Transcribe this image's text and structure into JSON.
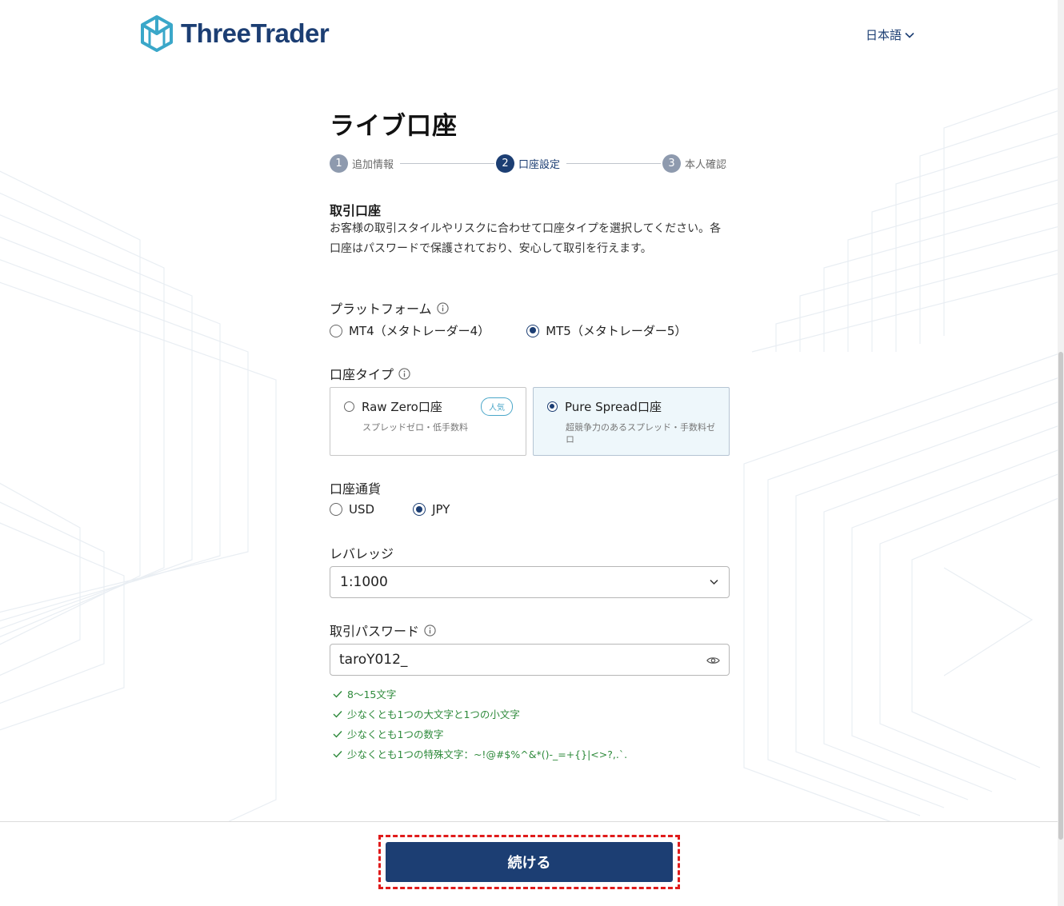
{
  "brand": {
    "name": "ThreeTrader",
    "color": "#1c3e73",
    "logo_icon": "cube-logo-icon"
  },
  "header": {
    "language": "日本語"
  },
  "page": {
    "title": "ライブ口座"
  },
  "stepper": {
    "steps": [
      {
        "number": "1",
        "label": "追加情報",
        "state": "inactive"
      },
      {
        "number": "2",
        "label": "口座設定",
        "state": "active"
      },
      {
        "number": "3",
        "label": "本人確認",
        "state": "inactive"
      }
    ]
  },
  "trading_account": {
    "title": "取引口座",
    "description": "お客様の取引スタイルやリスクに合わせて口座タイプを選択してください。各口座はパスワードで保護されており、安心して取引を行えます。"
  },
  "platform": {
    "label": "プラットフォーム",
    "options": [
      {
        "label": "MT4（メタトレーダー4）",
        "checked": false
      },
      {
        "label": "MT5（メタトレーダー5）",
        "checked": true
      }
    ]
  },
  "account_type": {
    "label": "口座タイプ",
    "cards": [
      {
        "name": "Raw Zero口座",
        "desc": "スプレッドゼロ・低手数料",
        "badge": "人気",
        "checked": false
      },
      {
        "name": "Pure Spread口座",
        "desc": "超競争力のあるスプレッド・手数料ゼロ",
        "checked": true
      }
    ]
  },
  "currency": {
    "label": "口座通貨",
    "options": [
      {
        "label": "USD",
        "checked": false
      },
      {
        "label": "JPY",
        "checked": true
      }
    ]
  },
  "leverage": {
    "label": "レバレッジ",
    "value": "1:1000"
  },
  "password": {
    "label": "取引パスワード",
    "value": "taroY012_",
    "rules": [
      "8～15文字",
      "少なくとも1つの大文字と1つの小文字",
      "少なくとも1つの数字",
      "少なくとも1つの特殊文字：~!@#$%^&*()-_=+{}|<>?,.`."
    ],
    "rule_color": "#2e8a3b"
  },
  "footer": {
    "continue_label": "続ける"
  },
  "colors": {
    "accent": "#1c3e73",
    "selected_card_bg": "#eef7fb",
    "highlight_border": "#e01b1b"
  }
}
